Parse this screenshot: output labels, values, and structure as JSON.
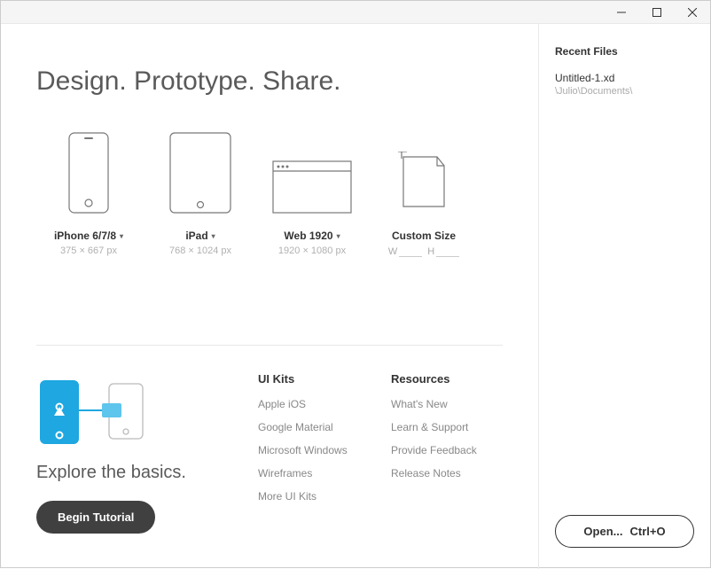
{
  "window": {
    "minimize": "—",
    "maximize": "▢",
    "close": "✕"
  },
  "headline": "Design. Prototype. Share.",
  "presets": [
    {
      "label": "iPhone 6/7/8",
      "dims": "375 × 667 px",
      "chevron": true
    },
    {
      "label": "iPad",
      "dims": "768 × 1024 px",
      "chevron": true
    },
    {
      "label": "Web 1920",
      "dims": "1920 × 1080 px",
      "chevron": true
    },
    {
      "label": "Custom Size",
      "dims": "",
      "chevron": false
    }
  ],
  "custom": {
    "w_label": "W",
    "h_label": "H"
  },
  "basics": {
    "caption": "Explore the basics.",
    "button": "Begin Tutorial"
  },
  "uikits": {
    "title": "UI Kits",
    "items": [
      "Apple iOS",
      "Google Material",
      "Microsoft Windows",
      "Wireframes",
      "More UI Kits"
    ]
  },
  "resources": {
    "title": "Resources",
    "items": [
      "What's New",
      "Learn & Support",
      "Provide Feedback",
      "Release Notes"
    ]
  },
  "recent": {
    "title": "Recent Files",
    "items": [
      {
        "name": "Untitled-1.xd",
        "path": "\\Julio\\Documents\\"
      }
    ]
  },
  "open_button": {
    "label": "Open...",
    "shortcut": "Ctrl+O"
  }
}
